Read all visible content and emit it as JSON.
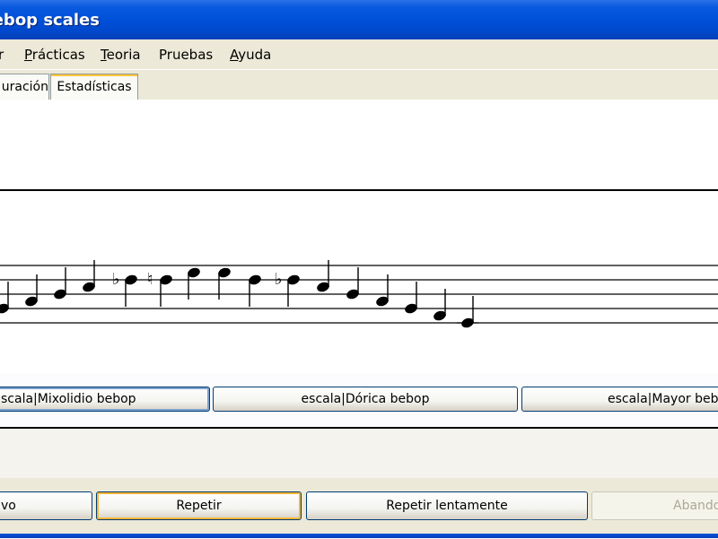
{
  "window": {
    "title": "Bebop scales"
  },
  "menu": [
    {
      "label": "r",
      "accel": ""
    },
    {
      "label": "Prácticas",
      "accel": "P"
    },
    {
      "label": "Teoria",
      "accel": "T"
    },
    {
      "label": "Pruebas",
      "accel": ""
    },
    {
      "label": "Ayuda",
      "accel": "A"
    }
  ],
  "tabs": [
    {
      "label": "uración"
    },
    {
      "label": "Estadísticas"
    }
  ],
  "staff": {
    "notes": [
      {
        "step": -2,
        "accidental": ""
      },
      {
        "step": -1,
        "accidental": ""
      },
      {
        "step": 0,
        "accidental": ""
      },
      {
        "step": 1,
        "accidental": ""
      },
      {
        "step": 2,
        "accidental": "flat"
      },
      {
        "step": 2,
        "accidental": "natural"
      },
      {
        "step": 3,
        "accidental": ""
      },
      {
        "step": 3,
        "accidental": ""
      },
      {
        "step": 2,
        "accidental": ""
      },
      {
        "step": 2,
        "accidental": "flat"
      },
      {
        "step": 1,
        "accidental": ""
      },
      {
        "step": 0,
        "accidental": ""
      },
      {
        "step": -1,
        "accidental": ""
      },
      {
        "step": -2,
        "accidental": ""
      },
      {
        "step": -3,
        "accidental": ""
      },
      {
        "step": -4,
        "accidental": ""
      }
    ]
  },
  "scale_buttons": [
    {
      "label": "scala|Mixolidio bebop"
    },
    {
      "label": "escala|Dórica bebop"
    },
    {
      "label": "escala|Mayor beb"
    }
  ],
  "bottom_buttons": [
    {
      "label": "vo"
    },
    {
      "label": "Repetir"
    },
    {
      "label": "Repetir lentamente"
    },
    {
      "label": "Abando"
    }
  ]
}
